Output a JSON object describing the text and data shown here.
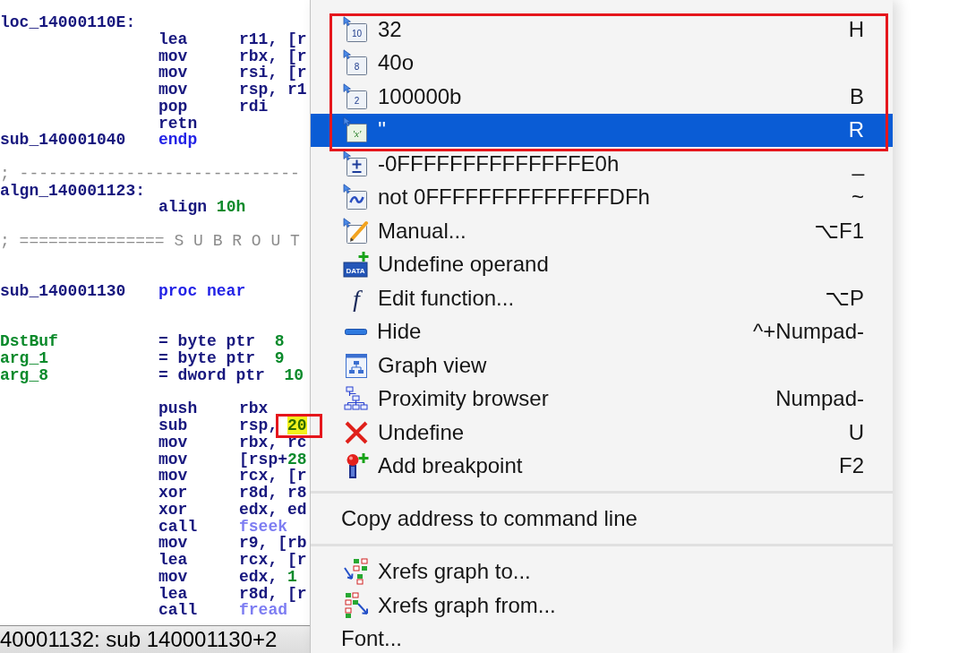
{
  "code": {
    "lines": [
      {
        "kind": "code",
        "label": {
          "text": "loc_14000110E:",
          "kind": "label"
        }
      },
      {
        "kind": "code",
        "instr": [
          {
            "text": "lea",
            "kind": "instr"
          }
        ],
        "operand": [
          {
            "text": "r11, [r",
            "kind": "reg"
          }
        ]
      },
      {
        "kind": "code",
        "instr": [
          {
            "text": "mov",
            "kind": "instr"
          }
        ],
        "operand": [
          {
            "text": "rbx, [r",
            "kind": "reg"
          }
        ]
      },
      {
        "kind": "code",
        "instr": [
          {
            "text": "mov",
            "kind": "instr"
          }
        ],
        "operand": [
          {
            "text": "rsi, [r",
            "kind": "reg"
          }
        ]
      },
      {
        "kind": "code",
        "instr": [
          {
            "text": "mov",
            "kind": "instr"
          }
        ],
        "operand": [
          {
            "text": "rsp, r1",
            "kind": "reg"
          }
        ]
      },
      {
        "kind": "code",
        "instr": [
          {
            "text": "pop",
            "kind": "instr"
          }
        ],
        "operand": [
          {
            "text": "rdi",
            "kind": "reg"
          }
        ]
      },
      {
        "kind": "code",
        "instr": [
          {
            "text": "retn",
            "kind": "instr"
          }
        ]
      },
      {
        "kind": "code",
        "label": {
          "text": "sub_140001040",
          "kind": "label"
        },
        "instr": [
          {
            "text": "endp",
            "kind": "keyword"
          }
        ]
      },
      {
        "kind": "blank"
      },
      {
        "kind": "code",
        "label": {
          "text": "; -----------------------------",
          "kind": "comment"
        }
      },
      {
        "kind": "code",
        "label": {
          "text": "algn_140001123:",
          "kind": "label"
        }
      },
      {
        "kind": "code",
        "instr": [
          {
            "text": "align ",
            "kind": "instr"
          },
          {
            "text": "10h",
            "kind": "num"
          }
        ]
      },
      {
        "kind": "blank"
      },
      {
        "kind": "code",
        "label": {
          "text": "; =============== S U B R O U T",
          "kind": "comment"
        }
      },
      {
        "kind": "blank"
      },
      {
        "kind": "blank"
      },
      {
        "kind": "code",
        "label": {
          "text": "sub_140001130",
          "kind": "label"
        },
        "instr": [
          {
            "text": "proc near",
            "kind": "keyword"
          }
        ]
      },
      {
        "kind": "blank"
      },
      {
        "kind": "blank"
      },
      {
        "kind": "code",
        "label": {
          "text": "DstBuf",
          "kind": "var"
        },
        "instr": [
          {
            "text": "= byte ptr  ",
            "kind": "instr"
          },
          {
            "text": "8",
            "kind": "num"
          }
        ]
      },
      {
        "kind": "code",
        "label": {
          "text": "arg_1",
          "kind": "var"
        },
        "instr": [
          {
            "text": "= byte ptr  ",
            "kind": "instr"
          },
          {
            "text": "9",
            "kind": "num"
          }
        ]
      },
      {
        "kind": "code",
        "label": {
          "text": "arg_8",
          "kind": "var"
        },
        "instr": [
          {
            "text": "= dword ptr  ",
            "kind": "instr"
          },
          {
            "text": "10",
            "kind": "num"
          }
        ]
      },
      {
        "kind": "blank"
      },
      {
        "kind": "code",
        "instr": [
          {
            "text": "push",
            "kind": "instr"
          }
        ],
        "operand": [
          {
            "text": "rbx",
            "kind": "reg"
          }
        ]
      },
      {
        "kind": "code",
        "instr": [
          {
            "text": "sub",
            "kind": "instr"
          }
        ],
        "operand": [
          {
            "text": "rsp, ",
            "kind": "reg"
          },
          {
            "text": "20",
            "kind": "highlight",
            "framed": true
          }
        ]
      },
      {
        "kind": "code",
        "instr": [
          {
            "text": "mov",
            "kind": "instr"
          }
        ],
        "operand": [
          {
            "text": "rbx, rc",
            "kind": "reg"
          }
        ]
      },
      {
        "kind": "code",
        "instr": [
          {
            "text": "mov",
            "kind": "instr"
          }
        ],
        "operand": [
          {
            "text": "[rsp+",
            "kind": "reg"
          },
          {
            "text": "28",
            "kind": "num"
          }
        ]
      },
      {
        "kind": "code",
        "instr": [
          {
            "text": "mov",
            "kind": "instr"
          }
        ],
        "operand": [
          {
            "text": "rcx, [r",
            "kind": "reg"
          }
        ]
      },
      {
        "kind": "code",
        "instr": [
          {
            "text": "xor",
            "kind": "instr"
          }
        ],
        "operand": [
          {
            "text": "r8d, r8",
            "kind": "reg"
          }
        ]
      },
      {
        "kind": "code",
        "instr": [
          {
            "text": "xor",
            "kind": "instr"
          }
        ],
        "operand": [
          {
            "text": "edx, ed",
            "kind": "reg"
          }
        ]
      },
      {
        "kind": "code",
        "instr": [
          {
            "text": "call",
            "kind": "instr"
          }
        ],
        "operand": [
          {
            "text": "fseek",
            "kind": "import"
          }
        ]
      },
      {
        "kind": "code",
        "instr": [
          {
            "text": "mov",
            "kind": "instr"
          }
        ],
        "operand": [
          {
            "text": "r9, [rb",
            "kind": "reg"
          }
        ]
      },
      {
        "kind": "code",
        "instr": [
          {
            "text": "lea",
            "kind": "instr"
          }
        ],
        "operand": [
          {
            "text": "rcx, [r",
            "kind": "reg"
          }
        ]
      },
      {
        "kind": "code",
        "instr": [
          {
            "text": "mov",
            "kind": "instr"
          }
        ],
        "operand": [
          {
            "text": "edx, ",
            "kind": "reg"
          },
          {
            "text": "1",
            "kind": "num"
          }
        ]
      },
      {
        "kind": "code",
        "instr": [
          {
            "text": "lea",
            "kind": "instr"
          }
        ],
        "operand": [
          {
            "text": "r8d, [r",
            "kind": "reg"
          }
        ]
      },
      {
        "kind": "code",
        "instr": [
          {
            "text": "call",
            "kind": "instr"
          }
        ],
        "operand": [
          {
            "text": "fread",
            "kind": "import"
          }
        ]
      }
    ]
  },
  "status_bar": {
    "text": "40001132: sub 140001130+2"
  },
  "menu": {
    "sections": [
      {
        "kind": "items",
        "framed": true,
        "items": [
          {
            "label": "32",
            "shortcut": "H",
            "icon_text": "10",
            "selected": false
          },
          {
            "label": "40o",
            "icon_text": "8",
            "selected": false
          },
          {
            "label": "100000b",
            "shortcut": "B",
            "icon_text": "2",
            "selected": false
          },
          {
            "label": "''",
            "shortcut": "R",
            "icon_text": "'x'",
            "selected": true
          }
        ]
      },
      {
        "kind": "items",
        "framed": false,
        "items": [
          {
            "label": "-0FFFFFFFFFFFFFFE0h",
            "shortcut": "_",
            "selected": false
          },
          {
            "label": "not 0FFFFFFFFFFFFFFDFh",
            "shortcut": "~",
            "selected": false
          },
          {
            "label": "Manual...",
            "shortcut": "⌥F1",
            "selected": false
          },
          {
            "label": "Undefine operand",
            "icon_text": "DATA",
            "selected": false
          },
          {
            "label": "Edit function...",
            "shortcut": "⌥P",
            "icon_text": "f",
            "selected": false
          },
          {
            "label": "Hide",
            "shortcut": "^+Numpad-",
            "selected": false
          },
          {
            "label": "Graph view",
            "selected": false
          },
          {
            "label": "Proximity browser",
            "shortcut": "Numpad-",
            "selected": false
          },
          {
            "label": "Undefine",
            "shortcut": "U",
            "selected": false
          },
          {
            "label": "Add breakpoint",
            "shortcut": "F2",
            "selected": false
          }
        ]
      },
      {
        "kind": "separator"
      },
      {
        "kind": "items",
        "framed": false,
        "items": [
          {
            "label": "Copy address to command line",
            "selected": false
          }
        ]
      },
      {
        "kind": "separator"
      },
      {
        "kind": "items",
        "framed": false,
        "items": [
          {
            "label": "Xrefs graph to...",
            "selected": false
          },
          {
            "label": "Xrefs graph from...",
            "selected": false
          },
          {
            "label": "Font...",
            "selected": false
          }
        ]
      }
    ]
  }
}
